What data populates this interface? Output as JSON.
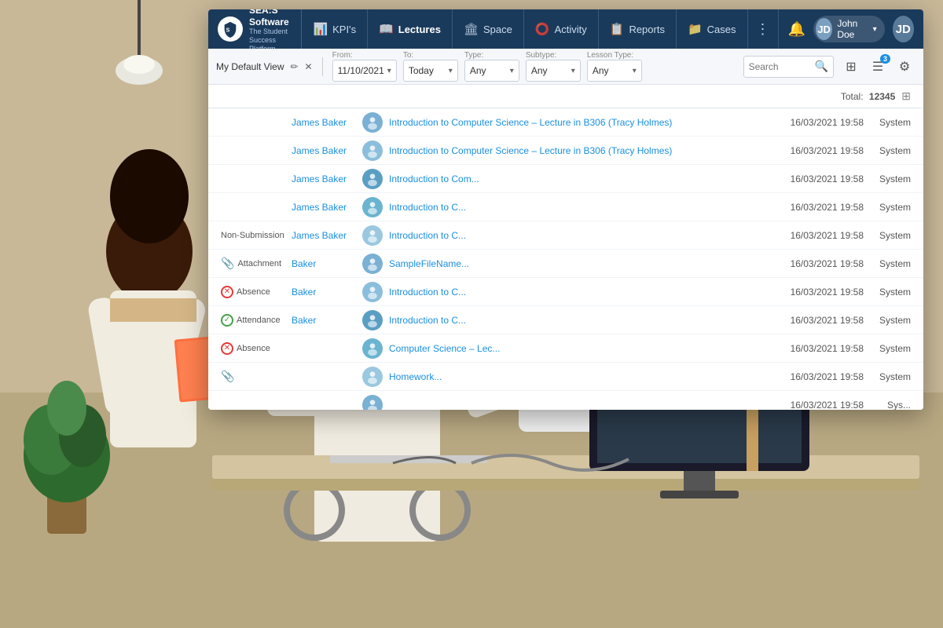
{
  "brand": {
    "name": "SEA:S Software",
    "tagline": "The Student Success Platform",
    "logo_text": "S"
  },
  "nav": {
    "items": [
      {
        "id": "kpis",
        "label": "KPI's",
        "icon": "📊",
        "active": false
      },
      {
        "id": "lectures",
        "label": "Lectures",
        "icon": "📖",
        "active": true
      },
      {
        "id": "space",
        "label": "Space",
        "icon": "🏛",
        "active": false
      },
      {
        "id": "activity",
        "label": "Activity",
        "icon": "⭕",
        "active": false
      },
      {
        "id": "reports",
        "label": "Reports",
        "icon": "📋",
        "active": false
      },
      {
        "id": "cases",
        "label": "Cases",
        "icon": "📁",
        "active": false
      }
    ],
    "more_icon": "⋮",
    "bell_icon": "🔔",
    "user": {
      "name": "John Doe",
      "avatar_initials": "JD"
    }
  },
  "toolbar": {
    "view_label": "My Default View",
    "edit_icon": "✏",
    "close_icon": "✕",
    "filters": {
      "from": {
        "label": "From:",
        "value": "11/10/2021"
      },
      "to": {
        "label": "To:",
        "value": "Today"
      },
      "type": {
        "label": "Type:",
        "value": "Any"
      },
      "subtype": {
        "label": "Subtype:",
        "value": "Any"
      },
      "lesson_type": {
        "label": "Lesson Type:",
        "value": "Any"
      }
    },
    "search_placeholder": "Search",
    "badge_count": "3"
  },
  "subheader": {
    "total_label": "Total:",
    "total_value": "12345",
    "columns_icon": "⊞"
  },
  "rows": [
    {
      "type": "",
      "type_icon": "",
      "student": "James Baker",
      "description": "Introduction to Computer Science – Lecture in B306 (Tracy Holmes)",
      "date": "16/03/2021 19:58",
      "source": "System"
    },
    {
      "type": "",
      "type_icon": "",
      "student": "James Baker",
      "description": "Introduction to Computer Science – Lecture in B306 (Tracy Holmes)",
      "date": "16/03/2021 19:58",
      "source": "System"
    },
    {
      "type": "",
      "type_icon": "",
      "student": "James Baker",
      "description": "Introduction to Com...",
      "date": "16/03/2021 19:58",
      "source": "System"
    },
    {
      "type": "",
      "type_icon": "",
      "student": "James Baker",
      "description": "Introduction to C...",
      "date": "16/03/2021 19:58",
      "source": "System"
    },
    {
      "type": "Non-Submission",
      "type_icon": "",
      "student": "James Baker",
      "description": "Introduction to C...",
      "date": "16/03/2021 19:58",
      "source": "System"
    },
    {
      "type": "Attachment",
      "type_icon": "📎",
      "student": "Baker",
      "description": "SampleFileName...",
      "date": "16/03/2021 19:58",
      "source": "System"
    },
    {
      "type": "Absence",
      "type_icon": "🔴",
      "student": "Baker",
      "description": "Introduction to C...",
      "date": "16/03/2021 19:58",
      "source": "System"
    },
    {
      "type": "Attendance",
      "type_icon": "🟢",
      "student": "Baker",
      "description": "Introduction to C...",
      "date": "16/03/2021 19:58",
      "source": "System"
    },
    {
      "type": "Absence",
      "type_icon": "🔴",
      "student": "",
      "description": "Computer Science – Lec...",
      "date": "16/03/2021 19:58",
      "source": "System"
    },
    {
      "type": "",
      "type_icon": "📎",
      "student": "",
      "description": "Homework...",
      "date": "16/03/2021 19:58",
      "source": "System"
    },
    {
      "type": "",
      "type_icon": "",
      "student": "",
      "description": "",
      "date": "16/03/2021 19:58",
      "source": "Sys..."
    }
  ]
}
